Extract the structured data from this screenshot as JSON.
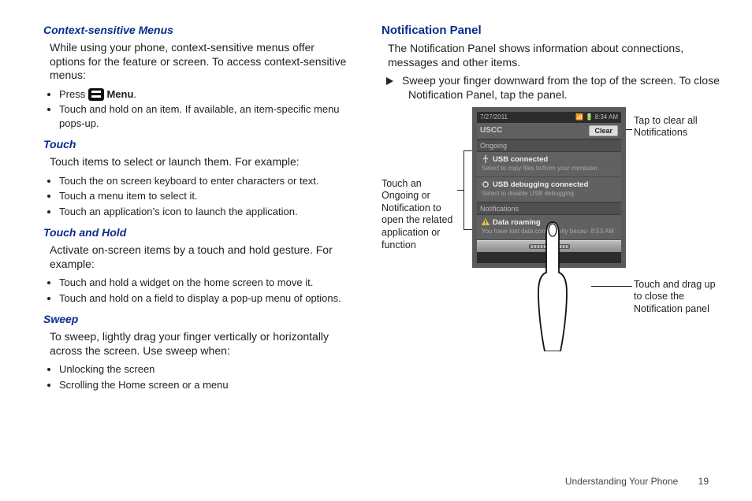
{
  "left": {
    "ctx_heading": "Context-sensitive Menus",
    "ctx_body": "While using your phone, context-sensitive menus offer options for the feature or screen. To access context-sensitive menus:",
    "ctx_b1_a": "Press ",
    "ctx_b1_b": "Menu",
    "ctx_b1_c": ".",
    "ctx_b2": "Touch and hold on an item. If available, an item-specific menu pops-up.",
    "touch_heading": "Touch",
    "touch_body": "Touch items to select or launch them. For example:",
    "touch_b1": "Touch the on screen keyboard to enter characters or text.",
    "touch_b2": "Touch a menu item to select it.",
    "touch_b3": "Touch an application’s icon to launch the application.",
    "tah_heading": "Touch and Hold",
    "tah_body": "Activate on-screen items by a touch and hold gesture. For example:",
    "tah_b1": "Touch and hold a widget on the home screen to move it.",
    "tah_b2": "Touch and hold on a field to display a pop-up menu of options.",
    "sweep_heading": "Sweep",
    "sweep_body": "To sweep, lightly drag your finger vertically or horizontally across the screen. Use sweep when:",
    "sweep_b1": "Unlocking the screen",
    "sweep_b2": "Scrolling the Home screen or a menu"
  },
  "right": {
    "heading": "Notification Panel",
    "body": "The Notification Panel shows information about connections, messages and other items.",
    "step": "Sweep your finger downward from the top of the screen. To close Notification Panel, tap the panel.",
    "callout_left": "Touch an Ongoing or Notification to open the related application or function",
    "callout_top_right": "Tap to clear all Notifications",
    "callout_bot_right": "Touch and drag up to close the Notification panel"
  },
  "phone": {
    "date": "7/27/2011",
    "time": "8:34 AM",
    "carrier": "USCC",
    "clear": "Clear",
    "ongoing_label": "Ongoing",
    "usb_title": "USB connected",
    "usb_sub": "Select to copy files to/from your computer.",
    "usbdbg_title": "USB debugging connected",
    "usbdbg_sub": "Select to disable USB debugging.",
    "notif_label": "Notifications",
    "roam_title": "Data roaming",
    "roam_sub": "You have lost data connectivity becau· 8:53 AM"
  },
  "footer": {
    "section": "Understanding Your Phone",
    "page": "19"
  }
}
